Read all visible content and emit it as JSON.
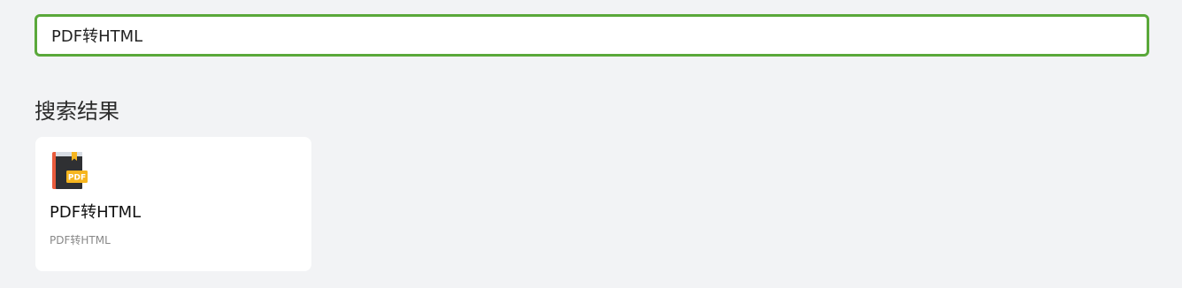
{
  "search": {
    "value": "PDF转HTML"
  },
  "results_section": {
    "title": "搜索结果"
  },
  "results": [
    {
      "title": "PDF转HTML",
      "description": "PDF转HTML",
      "icon": "pdf-book-icon",
      "icon_badge_text": "PDF"
    }
  ],
  "colors": {
    "accent_border": "#5aa83a",
    "page_background": "#f2f3f5",
    "card_background": "#ffffff",
    "book_cover": "#2f3033",
    "book_spine": "#e95b3c",
    "badge": "#f6b51e"
  }
}
